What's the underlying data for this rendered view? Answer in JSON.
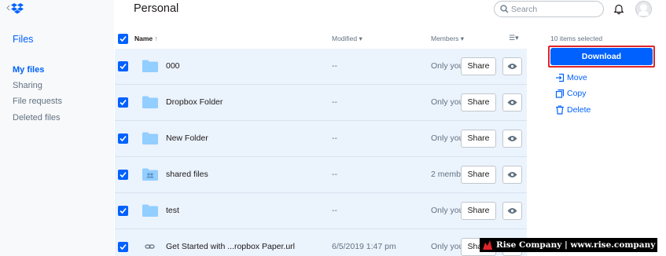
{
  "sidebar": {
    "files_heading": "Files",
    "items": [
      {
        "label": "My files",
        "active": true
      },
      {
        "label": "Sharing",
        "active": false
      },
      {
        "label": "File requests",
        "active": false
      },
      {
        "label": "Deleted files",
        "active": false
      }
    ]
  },
  "header": {
    "title": "Personal",
    "search_placeholder": "Search"
  },
  "columns": {
    "name": "Name",
    "name_sort": "↑",
    "modified": "Modified ▾",
    "members": "Members ▾",
    "view_toggle": "☰▾"
  },
  "rows": [
    {
      "name": "000",
      "icon": "folder-icon",
      "modified": "--",
      "members": "Only you",
      "share": "Share"
    },
    {
      "name": "Dropbox Folder",
      "icon": "folder-icon",
      "modified": "--",
      "members": "Only you",
      "share": "Share"
    },
    {
      "name": "New Folder",
      "icon": "folder-icon",
      "modified": "--",
      "members": "Only you",
      "share": "Share"
    },
    {
      "name": "shared files",
      "icon": "shared-folder-icon",
      "modified": "--",
      "members": "2 members",
      "share": "Share"
    },
    {
      "name": "test",
      "icon": "folder-icon",
      "modified": "--",
      "members": "Only you",
      "share": "Share"
    },
    {
      "name": "Get Started with ...ropbox Paper.url",
      "icon": "link-icon",
      "modified": "6/5/2019 1:47 pm",
      "members": "Only you",
      "share": "Share"
    }
  ],
  "right_panel": {
    "selected_count": "10 items selected",
    "download": "Download",
    "actions": [
      {
        "label": "Move",
        "icon": "move-icon"
      },
      {
        "label": "Copy",
        "icon": "copy-icon"
      },
      {
        "label": "Delete",
        "icon": "trash-icon"
      }
    ]
  },
  "watermark": {
    "text": "Rise Company | www.rise.company"
  },
  "colors": {
    "accent": "#0061fe",
    "row_selected": "#ebf3fd",
    "folder": "#92ceff",
    "highlight_frame": "#e0242a"
  }
}
